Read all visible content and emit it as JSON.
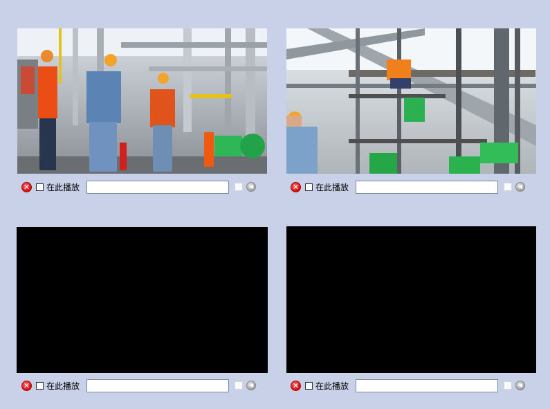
{
  "panels": [
    {
      "id": 1,
      "play_here_label": "在此播放",
      "input_value": "",
      "has_video": true
    },
    {
      "id": 2,
      "play_here_label": "在此播放",
      "input_value": "",
      "has_video": true
    },
    {
      "id": 3,
      "play_here_label": "在此播放",
      "input_value": "",
      "has_video": false
    },
    {
      "id": 4,
      "play_here_label": "在此播放",
      "input_value": "",
      "has_video": false
    }
  ],
  "icons": {
    "close": "close-icon",
    "speaker": "speaker-icon"
  },
  "colors": {
    "background": "#c8d1e8",
    "close_red": "#e21b1b",
    "video_black": "#000000"
  }
}
